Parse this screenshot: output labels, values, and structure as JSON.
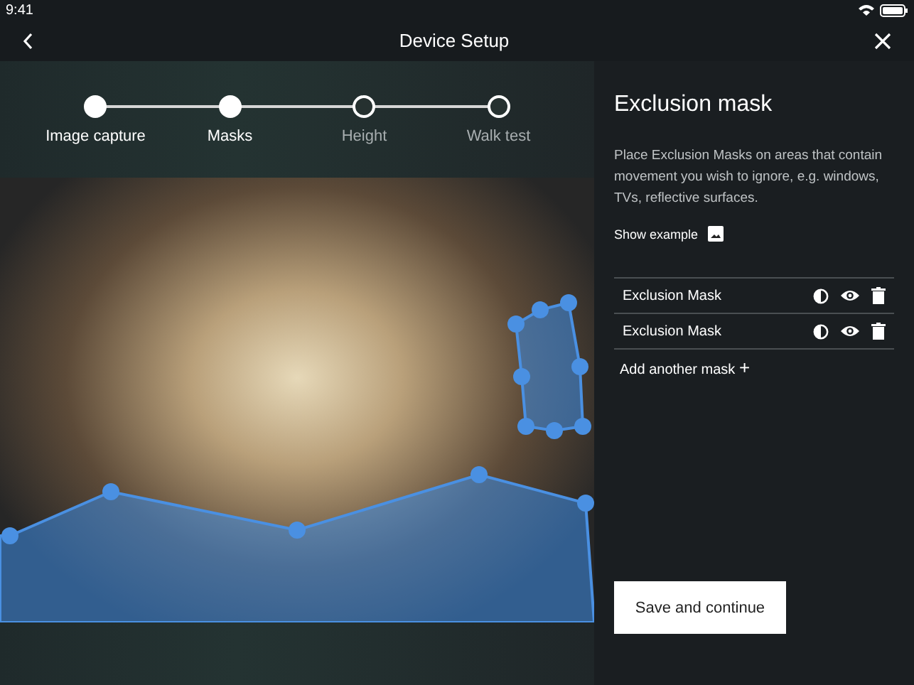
{
  "status_bar": {
    "time": "9:41"
  },
  "nav": {
    "title": "Device Setup"
  },
  "steps": [
    {
      "label": "Image capture",
      "completed": true
    },
    {
      "label": "Masks",
      "completed": true
    },
    {
      "label": "Height",
      "completed": false
    },
    {
      "label": "Walk test",
      "completed": false
    }
  ],
  "panel": {
    "title": "Exclusion mask",
    "description": "Place Exclusion Masks on areas that contain movement you wish to ignore, e.g. windows, TVs, reflective surfaces.",
    "show_example": "Show example",
    "masks": [
      {
        "name": "Exclusion Mask"
      },
      {
        "name": "Exclusion Mask"
      }
    ],
    "add_mask": "Add another mask",
    "add_icon": "+",
    "save_button": "Save and continue"
  }
}
